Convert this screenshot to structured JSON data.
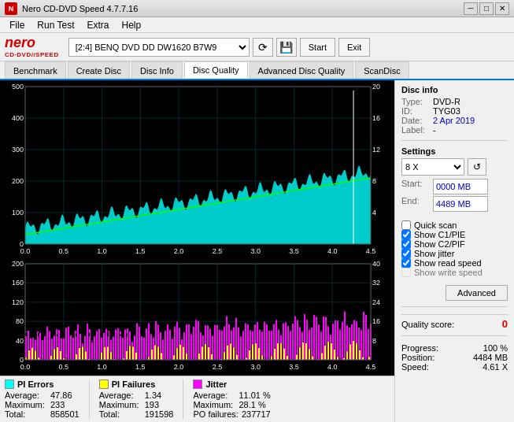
{
  "titleBar": {
    "text": "Nero CD-DVD Speed 4.7.7.16",
    "minBtn": "─",
    "maxBtn": "□",
    "closeBtn": "✕"
  },
  "menuBar": {
    "items": [
      "File",
      "Run Test",
      "Extra",
      "Help"
    ]
  },
  "toolbar": {
    "driveLabel": "[2:4]  BENQ DVD DD DW1620 B7W9",
    "startBtn": "Start",
    "exitBtn": "Exit"
  },
  "tabs": [
    {
      "label": "Benchmark",
      "active": false
    },
    {
      "label": "Create Disc",
      "active": false
    },
    {
      "label": "Disc Info",
      "active": false
    },
    {
      "label": "Disc Quality",
      "active": true
    },
    {
      "label": "Advanced Disc Quality",
      "active": false
    },
    {
      "label": "ScanDisc",
      "active": false
    }
  ],
  "discInfo": {
    "title": "Disc info",
    "typeLabel": "Type:",
    "typeValue": "DVD-R",
    "idLabel": "ID:",
    "idValue": "TYG03",
    "dateLabel": "Date:",
    "dateValue": "2 Apr 2019",
    "labelLabel": "Label:",
    "labelValue": "-"
  },
  "settings": {
    "title": "Settings",
    "speedValue": "8 X",
    "startLabel": "Start:",
    "startValue": "0000 MB",
    "endLabel": "End:",
    "endValue": "4489 MB"
  },
  "checkboxes": {
    "quickScan": {
      "label": "Quick scan",
      "checked": false
    },
    "showC1PIE": {
      "label": "Show C1/PIE",
      "checked": true
    },
    "showC2PIF": {
      "label": "Show C2/PIF",
      "checked": true
    },
    "showJitter": {
      "label": "Show jitter",
      "checked": true
    },
    "showReadSpeed": {
      "label": "Show read speed",
      "checked": true
    },
    "showWriteSpeed": {
      "label": "Show write speed",
      "checked": false,
      "disabled": true
    }
  },
  "advancedBtn": "Advanced",
  "qualityScore": {
    "label": "Quality score:",
    "value": "0"
  },
  "progress": {
    "progressLabel": "Progress:",
    "progressValue": "100 %",
    "positionLabel": "Position:",
    "positionValue": "4484 MB",
    "speedLabel": "Speed:",
    "speedValue": "4.61 X"
  },
  "stats": {
    "piErrors": {
      "legendColor": "#00ffff",
      "title": "PI Errors",
      "avgLabel": "Average:",
      "avgValue": "47.86",
      "maxLabel": "Maximum:",
      "maxValue": "233",
      "totalLabel": "Total:",
      "totalValue": "858501"
    },
    "piFailures": {
      "legendColor": "#ffff00",
      "title": "PI Failures",
      "avgLabel": "Average:",
      "avgValue": "1.34",
      "maxLabel": "Maximum:",
      "maxValue": "193",
      "totalLabel": "Total:",
      "totalValue": "191598"
    },
    "jitter": {
      "legendColor": "#ff00ff",
      "title": "Jitter",
      "avgLabel": "Average:",
      "avgValue": "11.01 %",
      "maxLabel": "Maximum:",
      "maxValue": "28.1 %",
      "poFailLabel": "PO failures:",
      "poFailValue": "237717"
    }
  },
  "charts": {
    "upper": {
      "yMax": "500",
      "y400": "400",
      "y300": "300",
      "y200": "200",
      "y100": "100",
      "yRight": [
        "20",
        "16",
        "12",
        "8",
        "4"
      ],
      "xLabels": [
        "0.0",
        "0.5",
        "1.0",
        "1.5",
        "2.0",
        "2.5",
        "3.0",
        "3.5",
        "4.0",
        "4.5"
      ]
    },
    "lower": {
      "yMax": "200",
      "y160": "160",
      "y120": "120",
      "y80": "80",
      "y40": "40",
      "yRight": [
        "40",
        "32",
        "24",
        "16",
        "8"
      ],
      "xLabels": [
        "0.0",
        "0.5",
        "1.0",
        "1.5",
        "2.0",
        "2.5",
        "3.0",
        "3.5",
        "4.0",
        "4.5"
      ]
    }
  }
}
